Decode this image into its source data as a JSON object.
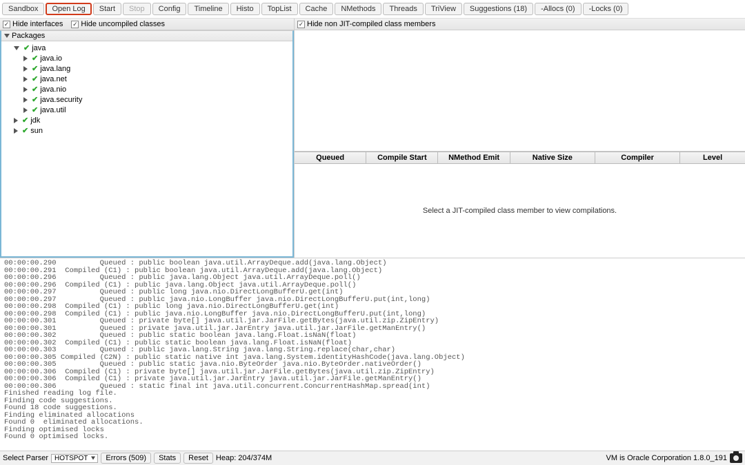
{
  "toolbar": {
    "buttons": [
      {
        "label": "Sandbox",
        "disabled": false,
        "highlight": false
      },
      {
        "label": "Open Log",
        "disabled": false,
        "highlight": true
      },
      {
        "label": "Start",
        "disabled": false,
        "highlight": false
      },
      {
        "label": "Stop",
        "disabled": true,
        "highlight": false
      },
      {
        "label": "Config",
        "disabled": false,
        "highlight": false
      },
      {
        "label": "Timeline",
        "disabled": false,
        "highlight": false
      },
      {
        "label": "Histo",
        "disabled": false,
        "highlight": false
      },
      {
        "label": "TopList",
        "disabled": false,
        "highlight": false
      },
      {
        "label": "Cache",
        "disabled": false,
        "highlight": false
      },
      {
        "label": "NMethods",
        "disabled": false,
        "highlight": false
      },
      {
        "label": "Threads",
        "disabled": false,
        "highlight": false
      },
      {
        "label": "TriView",
        "disabled": false,
        "highlight": false
      },
      {
        "label": "Suggestions (18)",
        "disabled": false,
        "highlight": false
      },
      {
        "label": "-Allocs (0)",
        "disabled": false,
        "highlight": false
      },
      {
        "label": "-Locks (0)",
        "disabled": false,
        "highlight": false
      }
    ]
  },
  "left": {
    "hide_interfaces": "Hide interfaces",
    "hide_uncompiled": "Hide uncompiled classes",
    "packages_label": "Packages",
    "tree": [
      {
        "label": "java",
        "level": 0,
        "expanded": true
      },
      {
        "label": "java.io",
        "level": 1,
        "expanded": false
      },
      {
        "label": "java.lang",
        "level": 1,
        "expanded": false
      },
      {
        "label": "java.net",
        "level": 1,
        "expanded": false
      },
      {
        "label": "java.nio",
        "level": 1,
        "expanded": false
      },
      {
        "label": "java.security",
        "level": 1,
        "expanded": false
      },
      {
        "label": "java.util",
        "level": 1,
        "expanded": false
      },
      {
        "label": "jdk",
        "level": 0,
        "expanded": false
      },
      {
        "label": "sun",
        "level": 0,
        "expanded": false
      }
    ]
  },
  "right": {
    "hide_non_jit": "Hide non JIT-compiled class members",
    "columns": [
      "Queued",
      "Compile Start",
      "NMethod Emit",
      "Native Size",
      "Compiler",
      "Level"
    ],
    "placeholder": "Select a JIT-compiled class member to view compilations."
  },
  "console_lines": [
    "00:00:00.290          Queued : public boolean java.util.ArrayDeque.add(java.lang.Object)",
    "00:00:00.291  Compiled (C1) : public boolean java.util.ArrayDeque.add(java.lang.Object)",
    "00:00:00.296          Queued : public java.lang.Object java.util.ArrayDeque.poll()",
    "00:00:00.296  Compiled (C1) : public java.lang.Object java.util.ArrayDeque.poll()",
    "00:00:00.297          Queued : public long java.nio.DirectLongBufferU.get(int)",
    "00:00:00.297          Queued : public java.nio.LongBuffer java.nio.DirectLongBufferU.put(int,long)",
    "00:00:00.298  Compiled (C1) : public long java.nio.DirectLongBufferU.get(int)",
    "00:00:00.298  Compiled (C1) : public java.nio.LongBuffer java.nio.DirectLongBufferU.put(int,long)",
    "00:00:00.301          Queued : private byte[] java.util.jar.JarFile.getBytes(java.util.zip.ZipEntry)",
    "00:00:00.301          Queued : private java.util.jar.JarEntry java.util.jar.JarFile.getManEntry()",
    "00:00:00.302          Queued : public static boolean java.lang.Float.isNaN(float)",
    "00:00:00.302  Compiled (C1) : public static boolean java.lang.Float.isNaN(float)",
    "00:00:00.303          Queued : public java.lang.String java.lang.String.replace(char,char)",
    "00:00:00.305 Compiled (C2N) : public static native int java.lang.System.identityHashCode(java.lang.Object)",
    "00:00:00.305          Queued : public static java.nio.ByteOrder java.nio.ByteOrder.nativeOrder()",
    "00:00:00.306  Compiled (C1) : private byte[] java.util.jar.JarFile.getBytes(java.util.zip.ZipEntry)",
    "00:00:00.306  Compiled (C1) : private java.util.jar.JarEntry java.util.jar.JarFile.getManEntry()",
    "00:00:00.306          Queued : static final int java.util.concurrent.ConcurrentHashMap.spread(int)",
    "Finished reading log file.",
    "Finding code suggestions.",
    "Found 18 code suggestions.",
    "Finding eliminated allocations",
    "Found 0  eliminated allocations.",
    "Finding optimised locks",
    "Found 0 optimised locks."
  ],
  "status": {
    "select_parser": "Select Parser",
    "parser_value": "HOTSPOT",
    "errors": "Errors (509)",
    "stats": "Stats",
    "reset": "Reset",
    "heap": "Heap: 204/374M",
    "vm": "VM is Oracle Corporation 1.8.0_191"
  }
}
